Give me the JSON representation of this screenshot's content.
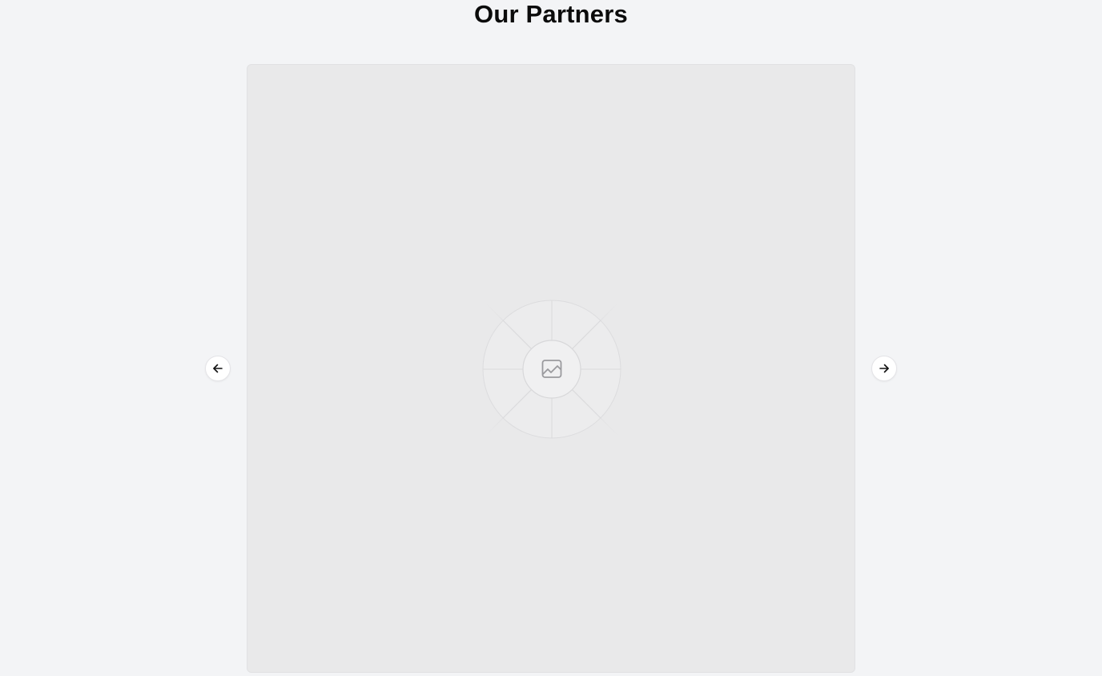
{
  "section": {
    "title": "Our Partners"
  },
  "carousel": {
    "slide_image_icon": "image-placeholder-icon",
    "prev_icon": "arrow-left-icon",
    "next_icon": "arrow-right-icon"
  },
  "colors": {
    "background": "#f3f4f6",
    "slide_background": "#e9e9ea",
    "title_text": "#0b0b0b",
    "button_background": "#ffffff"
  }
}
